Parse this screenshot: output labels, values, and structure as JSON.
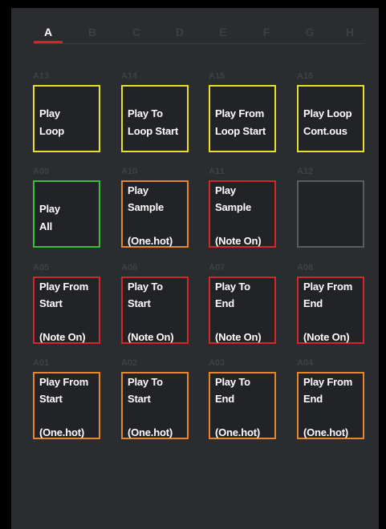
{
  "tabs": [
    "A",
    "B",
    "C",
    "D",
    "E",
    "F",
    "G",
    "H"
  ],
  "active_tab": "A",
  "colors": {
    "yellow": "#e8de2c",
    "green": "#35c034",
    "orange": "#e6862a",
    "red": "#d5262b",
    "empty": "#5b5c60",
    "accent": "#d4232c"
  },
  "pads": [
    {
      "id": "A13",
      "color": "yellow",
      "l1": "Play",
      "l2": "Loop",
      "l3": ""
    },
    {
      "id": "A14",
      "color": "yellow",
      "l1": "Play To",
      "l2": "Loop Start",
      "l3": ""
    },
    {
      "id": "A15",
      "color": "yellow",
      "l1": "Play From",
      "l2": "Loop Start",
      "l3": ""
    },
    {
      "id": "A16",
      "color": "yellow",
      "l1": "Play Loop",
      "l2": "Cont.ous",
      "l3": ""
    },
    {
      "id": "A09",
      "color": "green",
      "l1": "Play",
      "l2": "All",
      "l3": ""
    },
    {
      "id": "A10",
      "color": "orange",
      "l1": "Play",
      "l2": "Sample",
      "l3": "(One.hot)"
    },
    {
      "id": "A11",
      "color": "red",
      "l1": "Play",
      "l2": "Sample",
      "l3": "(Note On)"
    },
    {
      "id": "A12",
      "color": "empty",
      "l1": "",
      "l2": "",
      "l3": ""
    },
    {
      "id": "A05",
      "color": "red",
      "l1": "Play From",
      "l2": "Start",
      "l3": "(Note On)"
    },
    {
      "id": "A06",
      "color": "red",
      "l1": "Play To",
      "l2": "Start",
      "l3": "(Note On)"
    },
    {
      "id": "A07",
      "color": "red",
      "l1": "Play To",
      "l2": "End",
      "l3": "(Note On)"
    },
    {
      "id": "A08",
      "color": "red",
      "l1": "Play From",
      "l2": "End",
      "l3": "(Note On)"
    },
    {
      "id": "A01",
      "color": "orange",
      "l1": "Play From",
      "l2": "Start",
      "l3": "(One.hot)"
    },
    {
      "id": "A02",
      "color": "orange",
      "l1": "Play To",
      "l2": "Start",
      "l3": "(One.hot)"
    },
    {
      "id": "A03",
      "color": "orange",
      "l1": "Play To",
      "l2": "End",
      "l3": "(One.hot)"
    },
    {
      "id": "A04",
      "color": "orange",
      "l1": "Play From",
      "l2": "End",
      "l3": "(One.hot)"
    }
  ]
}
